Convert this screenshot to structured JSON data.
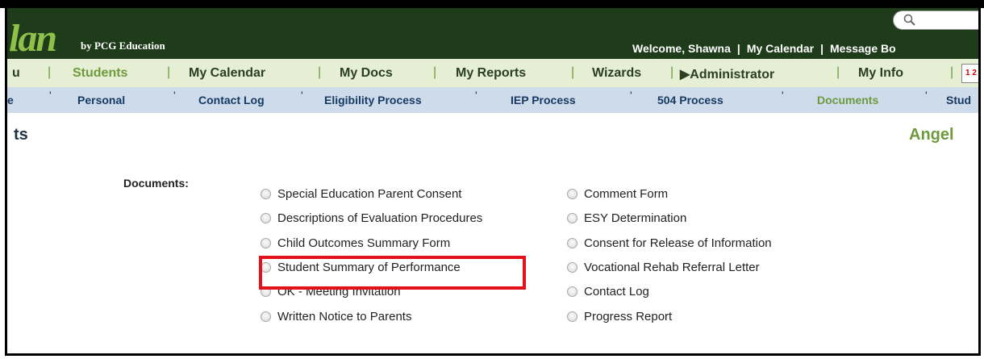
{
  "header": {
    "logo": "lan",
    "logo_by": "by PCG Education",
    "welcome": "Welcome, Shawna",
    "my_calendar": "My Calendar",
    "message_board": "Message Bo",
    "sep": "|"
  },
  "nav1": {
    "items": [
      "u",
      "Students",
      "My Calendar",
      "My Docs",
      "My Reports",
      "Wizards",
      "▶Administrator",
      "My Info"
    ],
    "sep": "|",
    "icon_label": "1 2"
  },
  "nav2": {
    "items": [
      "e",
      "Personal",
      "Contact Log",
      "Eligibility Process",
      "IEP Process",
      "504 Process",
      "Documents",
      "Stud"
    ],
    "sep": "'"
  },
  "page": {
    "title": "ts",
    "student": "Angel"
  },
  "documents": {
    "label": "Documents:",
    "left": [
      "Special Education Parent Consent",
      "Descriptions of Evaluation Procedures",
      "Child Outcomes Summary Form",
      "Student Summary of Performance",
      "OK - Meeting Invitation",
      "Written Notice to Parents"
    ],
    "right": [
      "Comment Form",
      "ESY Determination",
      "Consent for Release of Information",
      "Vocational Rehab Referral Letter",
      "Contact Log",
      "Progress Report"
    ]
  },
  "colors": {
    "header_bg": "#1f3c1a",
    "accent_green": "#6e9a3e",
    "nav2_bg": "#cddbeb",
    "highlight": "#e4101a"
  }
}
